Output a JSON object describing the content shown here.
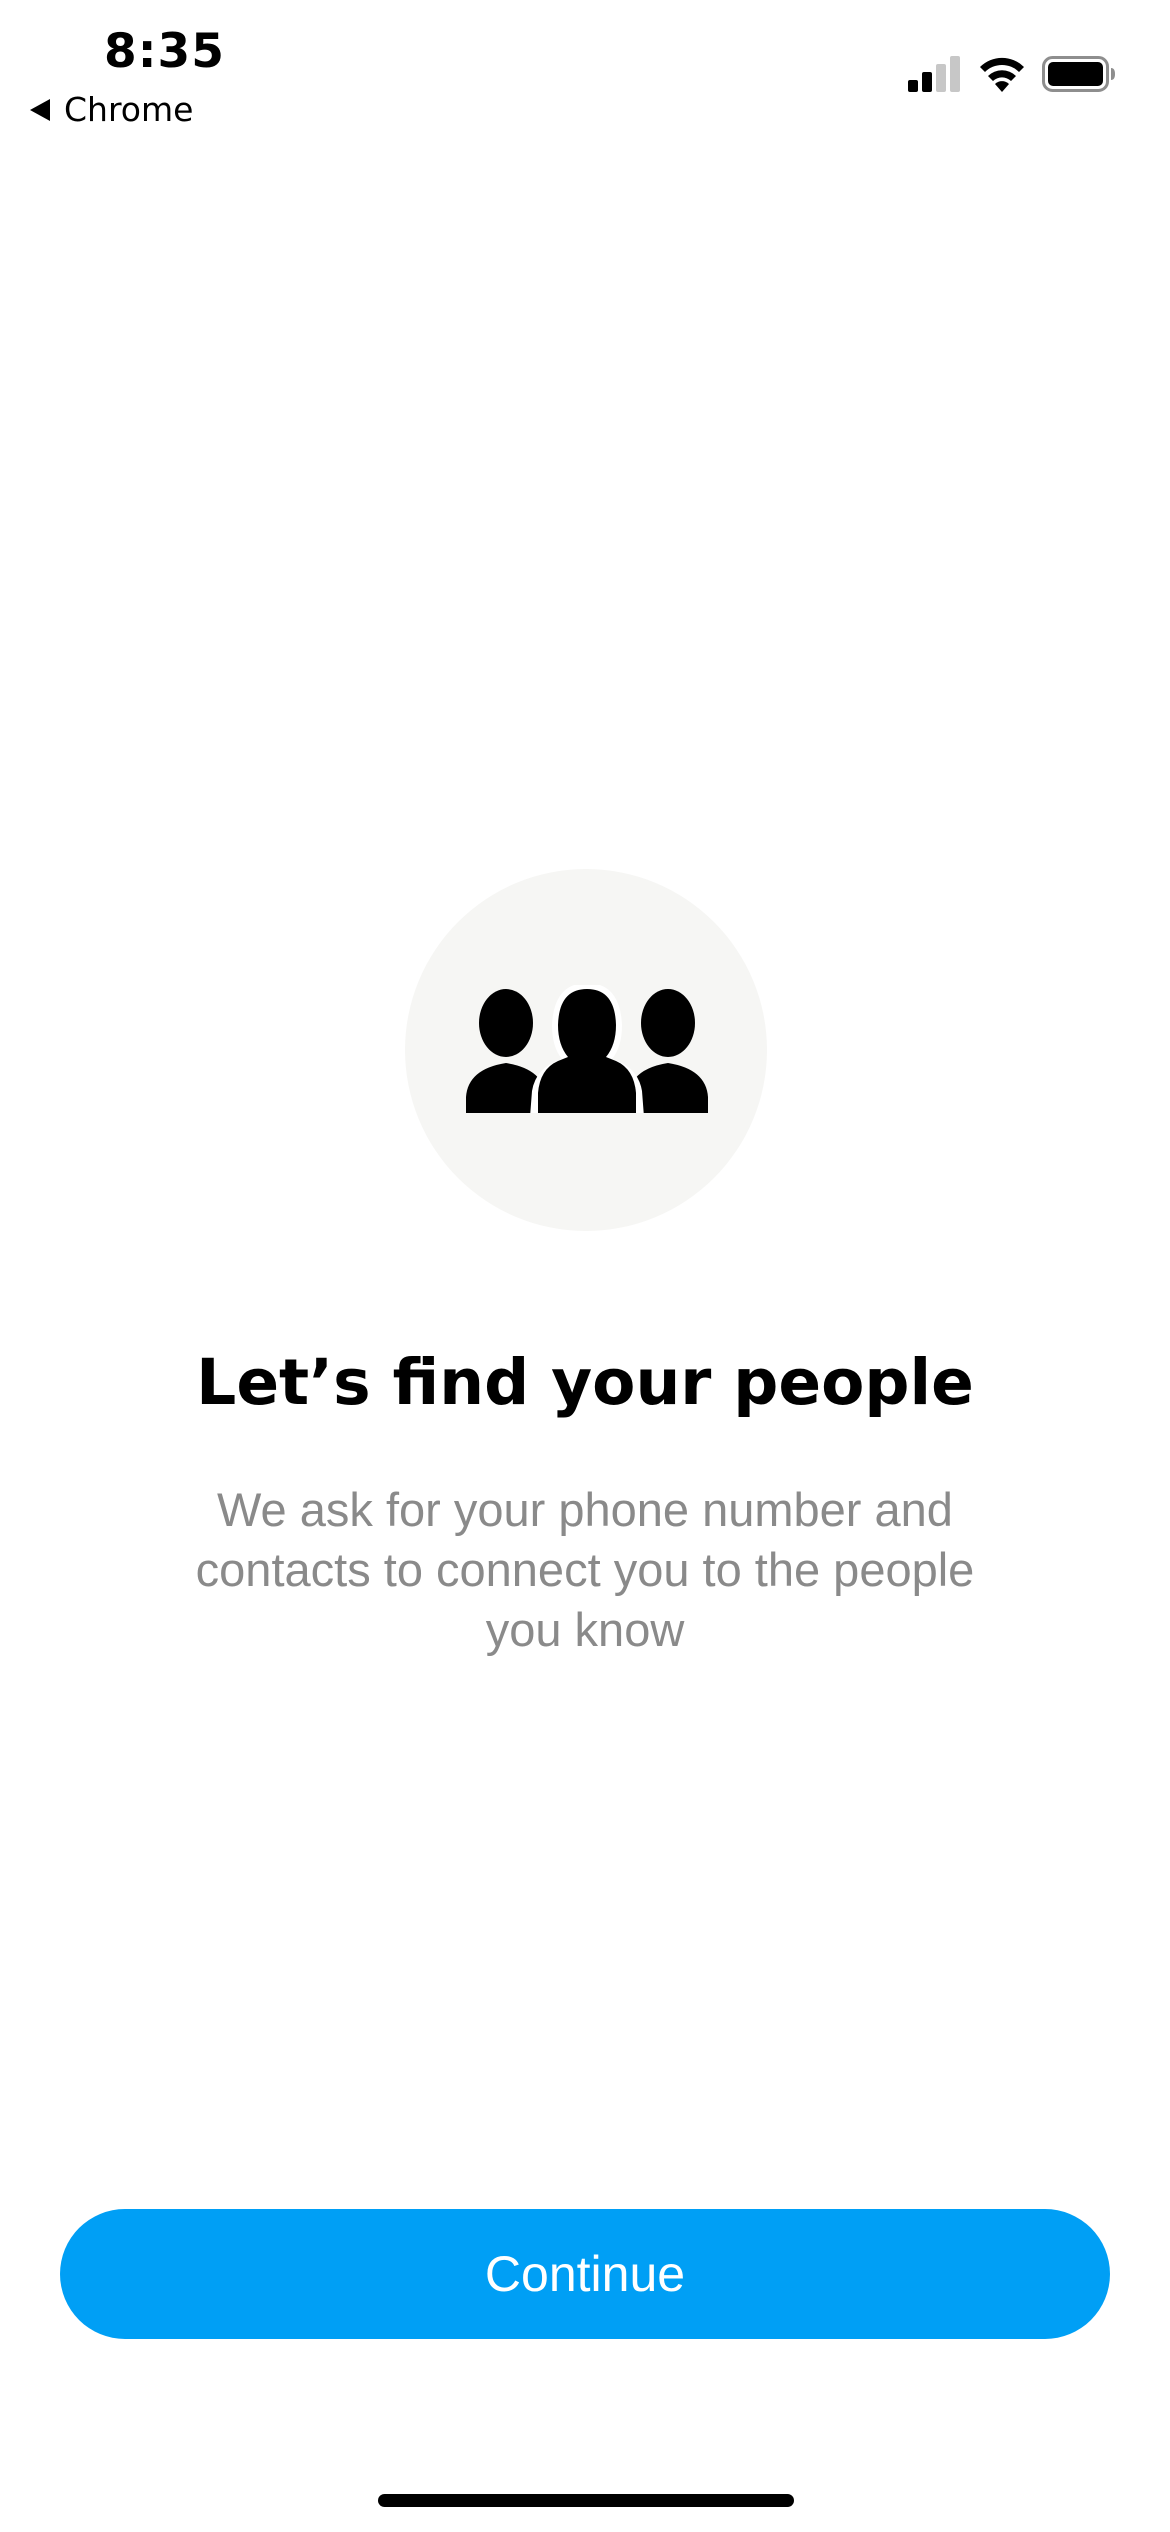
{
  "status_bar": {
    "time": "8:35",
    "back_app_label": "Chrome",
    "signal_icon": "cellular-signal-icon",
    "wifi_icon": "wifi-icon",
    "battery_icon": "battery-icon"
  },
  "illustration": {
    "icon": "people-group-icon",
    "circle_color": "#f6f6f4"
  },
  "content": {
    "headline": "Let’s find your people",
    "description": "We ask for your phone number and contacts to connect you to the people you know"
  },
  "actions": {
    "continue_label": "Continue",
    "accent_color": "#009ff5"
  }
}
